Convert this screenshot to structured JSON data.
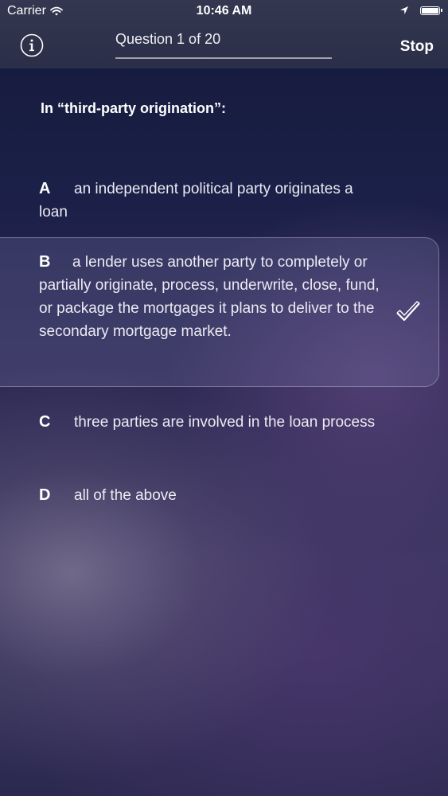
{
  "status_bar": {
    "carrier": "Carrier",
    "time": "10:46 AM",
    "battery_percent": 100
  },
  "nav": {
    "title": "Question 1 of 20",
    "stop_label": "Stop"
  },
  "question": {
    "text": "In “third-party origination”:"
  },
  "answers": [
    {
      "letter": "A",
      "text": "an independent political party originates a loan",
      "selected": false
    },
    {
      "letter": "B",
      "text": "a lender uses another party to completely or partially originate, process, underwrite, close, fund, or package the mortgages it plans to deliver to the secondary mortgage market.",
      "selected": true
    },
    {
      "letter": "C",
      "text": "three parties are involved in the loan process",
      "selected": false
    },
    {
      "letter": "D",
      "text": "all of the above",
      "selected": false
    }
  ],
  "colors": {
    "background_top": "#141a3a",
    "background_bottom": "#2c2950",
    "header": "#2f334c",
    "selected_card": "#5a5784"
  },
  "icons": [
    "wifi-icon",
    "location-arrow-icon",
    "battery-icon",
    "info-icon",
    "checkmark-icon"
  ]
}
